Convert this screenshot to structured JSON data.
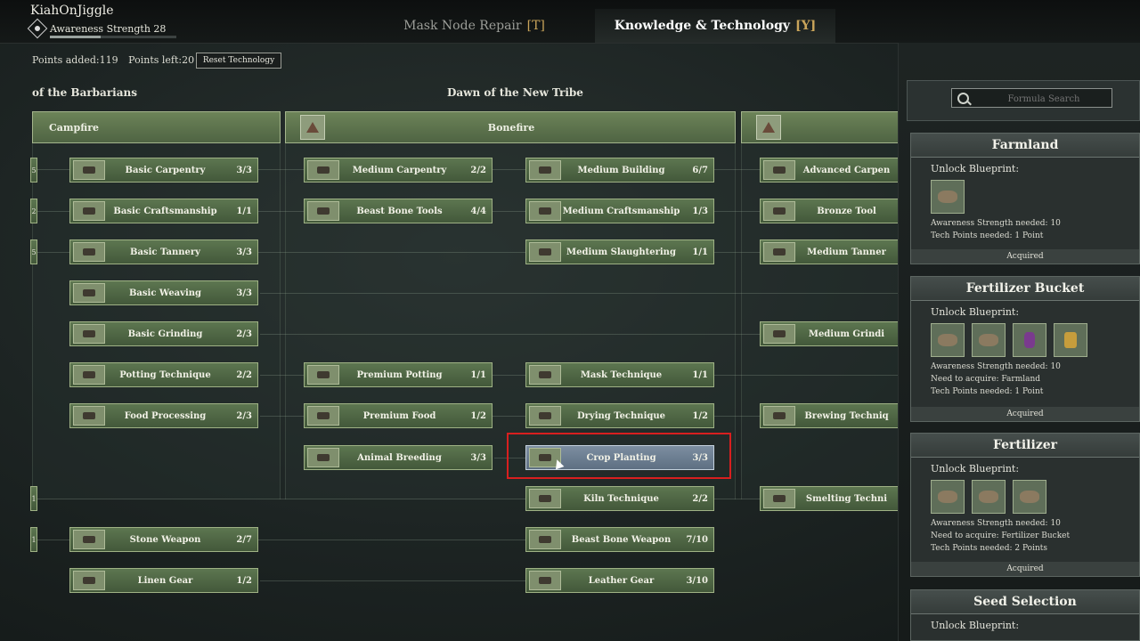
{
  "player": {
    "name": "KiahOnJiggle",
    "awareness_label": "Awareness Strength 28",
    "awareness_progress": 0.4
  },
  "tabs": [
    {
      "label": "Mask Node Repair",
      "key": "[T]"
    },
    {
      "label": "Knowledge & Technology",
      "key": "[Y]"
    }
  ],
  "points": {
    "added": "Points added:119",
    "left": "Points left:20",
    "reset_label": "Reset Technology"
  },
  "columns": {
    "left": "of the Barbarians",
    "middle": "Dawn of the New Tribe"
  },
  "tiers": {
    "campfire": "Campfire",
    "bonefire": "Bonefire"
  },
  "stubs": [
    "5",
    "2",
    "5",
    "1",
    "1"
  ],
  "col1": [
    {
      "name": "Basic Carpentry",
      "count": "3/3"
    },
    {
      "name": "Basic Craftsmanship",
      "count": "1/1"
    },
    {
      "name": "Basic Tannery",
      "count": "3/3"
    },
    {
      "name": "Basic Weaving",
      "count": "3/3"
    },
    {
      "name": "Basic Grinding",
      "count": "2/3"
    },
    {
      "name": "Potting Technique",
      "count": "2/2"
    },
    {
      "name": "Food Processing",
      "count": "2/3"
    },
    {
      "name": "Stone Weapon",
      "count": "2/7"
    },
    {
      "name": "Linen Gear",
      "count": "1/2"
    }
  ],
  "col2": [
    {
      "name": "Medium Carpentry",
      "count": "2/2"
    },
    {
      "name": "Beast Bone Tools",
      "count": "4/4"
    },
    {
      "name": "Premium Potting",
      "count": "1/1"
    },
    {
      "name": "Premium Food",
      "count": "1/2"
    },
    {
      "name": "Animal Breeding",
      "count": "3/3"
    }
  ],
  "col3": [
    {
      "name": "Medium Building",
      "count": "6/7"
    },
    {
      "name": "Medium Craftsmanship",
      "count": "1/3"
    },
    {
      "name": "Medium Slaughtering",
      "count": "1/1"
    },
    {
      "name": "Mask Technique",
      "count": "1/1"
    },
    {
      "name": "Drying Technique",
      "count": "1/2"
    },
    {
      "name": "Crop Planting",
      "count": "3/3"
    },
    {
      "name": "Kiln Technique",
      "count": "2/2"
    },
    {
      "name": "Beast Bone Weapon",
      "count": "7/10"
    },
    {
      "name": "Leather Gear",
      "count": "3/10"
    }
  ],
  "col4": [
    {
      "name": "Advanced Carpen"
    },
    {
      "name": "Bronze Tool"
    },
    {
      "name": "Medium Tanner"
    },
    {
      "name": "Medium Grindi"
    },
    {
      "name": "Brewing Techniq"
    },
    {
      "name": "Smelting Techni"
    }
  ],
  "search": {
    "placeholder": "Formula Search"
  },
  "cards": [
    {
      "title": "Farmland",
      "unlock": "Unlock Blueprint:",
      "awareness": "Awareness Strength needed: 10",
      "need": "",
      "points": "Tech Points needed: 1 Point",
      "status": "Acquired"
    },
    {
      "title": "Fertilizer Bucket",
      "unlock": "Unlock Blueprint:",
      "awareness": "Awareness Strength needed: 10",
      "need": "Need to acquire: Farmland",
      "points": "Tech Points needed: 1 Point",
      "status": "Acquired"
    },
    {
      "title": "Fertilizer",
      "unlock": "Unlock Blueprint:",
      "awareness": "Awareness Strength needed: 10",
      "need": "Need to acquire: Fertilizer Bucket",
      "points": "Tech Points needed: 2 Points",
      "status": "Acquired"
    },
    {
      "title": "Seed Selection",
      "unlock": "Unlock Blueprint:"
    }
  ]
}
